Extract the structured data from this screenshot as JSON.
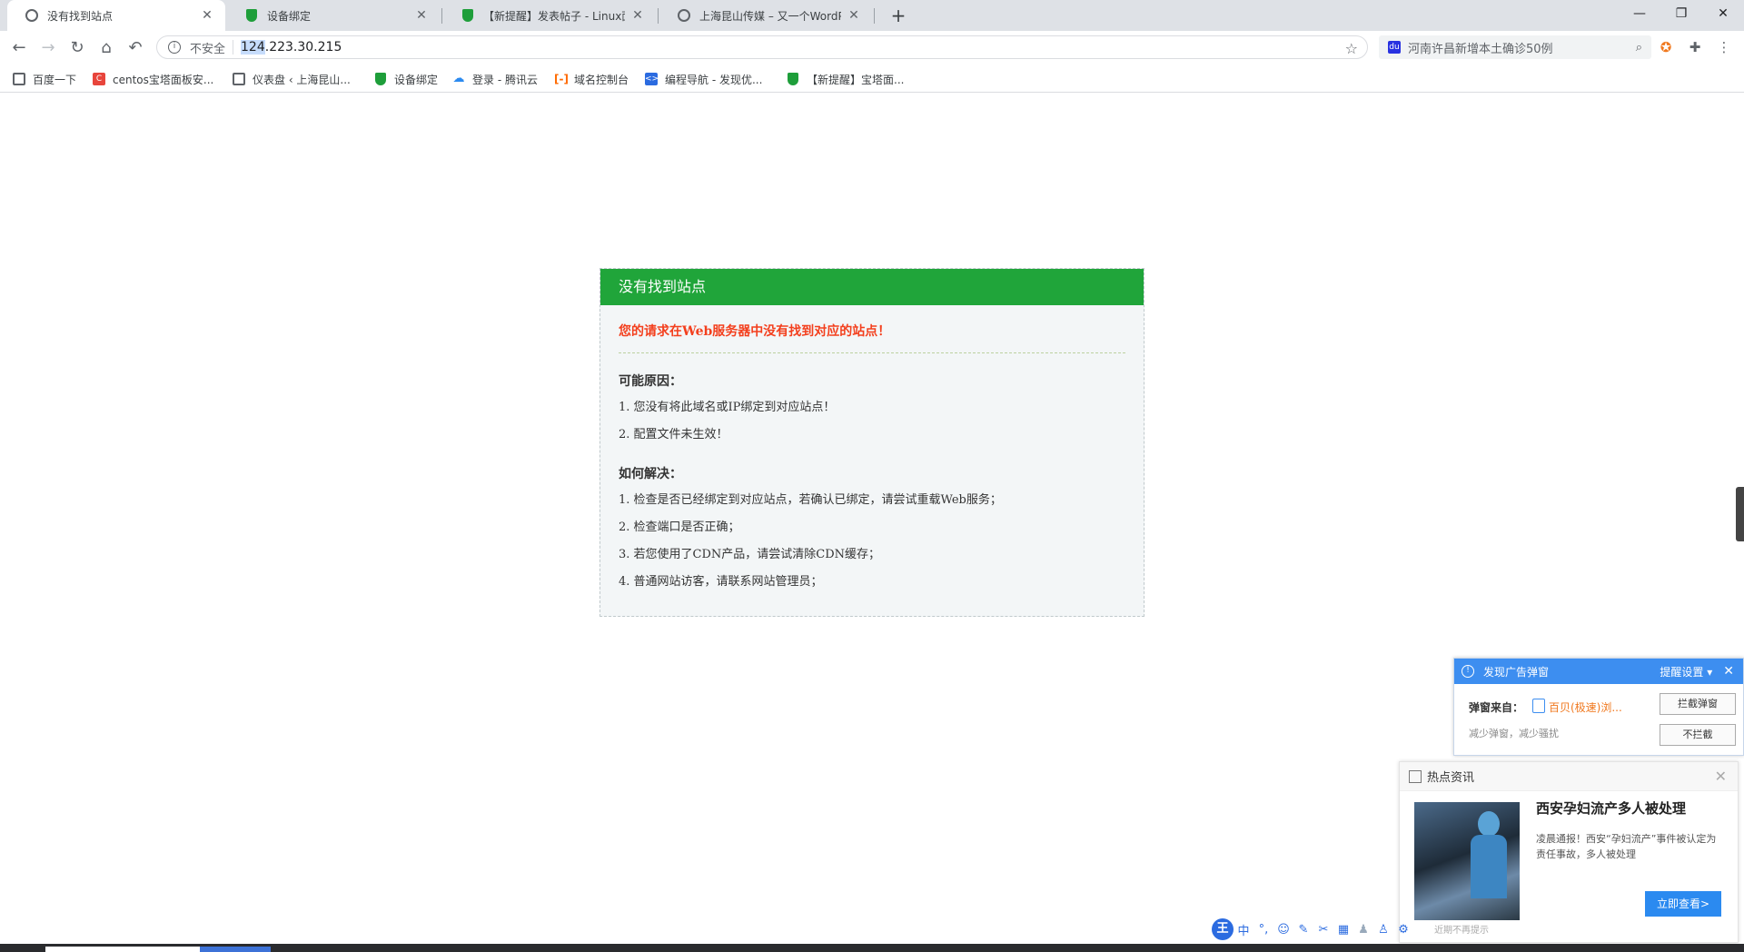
{
  "tabs": [
    {
      "title": "没有找到站点",
      "active": true,
      "icon": "globe-icon"
    },
    {
      "title": "设备绑定",
      "active": false,
      "icon": "shield-icon"
    },
    {
      "title": "【新提醒】发表帖子 - Linux面板",
      "active": false,
      "icon": "shield-icon"
    },
    {
      "title": "上海昆山传媒 – 又一个WordPress",
      "active": false,
      "icon": "globe-icon"
    }
  ],
  "toolbar": {
    "security_label": "不安全",
    "url_highlight": "124",
    "url_rest": ".223.30.215"
  },
  "search": {
    "text": "河南许昌新增本土确诊50例"
  },
  "bookmarks": [
    {
      "label": "百度一下",
      "icon": "globe-icon",
      "color": "#5f6368"
    },
    {
      "label": "centos宝塔面板安...",
      "icon": "c-logo-icon",
      "color": "#e8453c"
    },
    {
      "label": "仪表盘 ‹ 上海昆山...",
      "icon": "globe-icon",
      "color": "#5f6368"
    },
    {
      "label": "设备绑定",
      "icon": "shield-icon",
      "color": "#1e9e3a"
    },
    {
      "label": "登录 - 腾讯云",
      "icon": "cloud-icon",
      "color": "#2b8af0"
    },
    {
      "label": "域名控制台",
      "icon": "aliyun-icon",
      "color": "#ff6a00"
    },
    {
      "label": "编程导航 - 发现优...",
      "icon": "code-icon",
      "color": "#2b6be0"
    },
    {
      "label": "【新提醒】宝塔面...",
      "icon": "shield-icon",
      "color": "#1e9e3a"
    }
  ],
  "error": {
    "header": "没有找到站点",
    "title": "您的请求在Web服务器中没有找到对应的站点！",
    "reasons_heading": "可能原因：",
    "reasons": [
      "1. 您没有将此域名或IP绑定到对应站点！",
      "2. 配置文件未生效！"
    ],
    "solutions_heading": "如何解决：",
    "solutions": [
      "1. 检查是否已经绑定到对应站点，若确认已绑定，请尝试重载Web服务；",
      "2. 检查端口是否正确；",
      "3. 若您使用了CDN产品，请尝试清除CDN缓存；",
      "4. 普通网站访客，请联系网站管理员；"
    ]
  },
  "ad_popup": {
    "title": "发现广告弹窗",
    "settings": "提醒设置",
    "from_label": "弹窗来自：",
    "from_value": "百贝(极速)浏...",
    "subtitle": "减少弹窗，减少骚扰",
    "block_button": "拦截弹窗",
    "allow_button": "不拦截"
  },
  "news": {
    "heading": "热点资讯",
    "headline": "西安孕妇流产多人被处理",
    "desc": "凌晨通报！西安“孕妇流产”事件被认定为责任事故，多人被处理",
    "button": "立即查看>",
    "footer": "近期不再提示"
  },
  "ime": {
    "logo": "王",
    "mode": "中"
  },
  "colors": {
    "accent_green": "#20a53a",
    "error_red": "#f33f1d",
    "popup_blue": "#3d8ef0"
  }
}
